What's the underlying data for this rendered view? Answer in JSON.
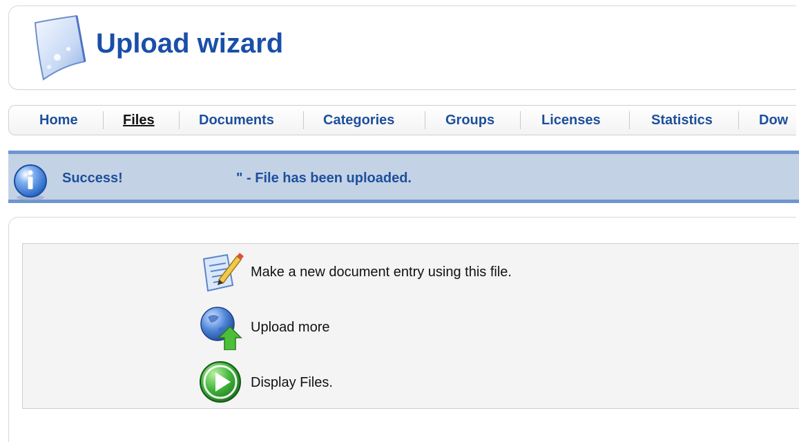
{
  "header": {
    "title": "Upload wizard",
    "icon": "document-page-icon"
  },
  "nav": {
    "items": [
      {
        "label": "Home",
        "active": false
      },
      {
        "label": "Files",
        "active": true
      },
      {
        "label": "Documents",
        "active": false
      },
      {
        "label": "Categories",
        "active": false
      },
      {
        "label": "Groups",
        "active": false
      },
      {
        "label": "Licenses",
        "active": false
      },
      {
        "label": "Statistics",
        "active": false
      },
      {
        "label": "Dow",
        "active": false
      }
    ]
  },
  "message": {
    "icon": "info-icon",
    "label": "Success!",
    "text": "\" - File has been uploaded."
  },
  "actions": [
    {
      "icon": "edit-document-icon",
      "label": "Make a new document entry using this file."
    },
    {
      "icon": "upload-globe-icon",
      "label": "Upload more"
    },
    {
      "icon": "play-icon",
      "label": "Display Files."
    }
  ],
  "colors": {
    "title": "#1a4fa8",
    "nav_link": "#1d4f9c",
    "message_bg": "#c4d2e6",
    "message_border": "#6f95cf"
  }
}
